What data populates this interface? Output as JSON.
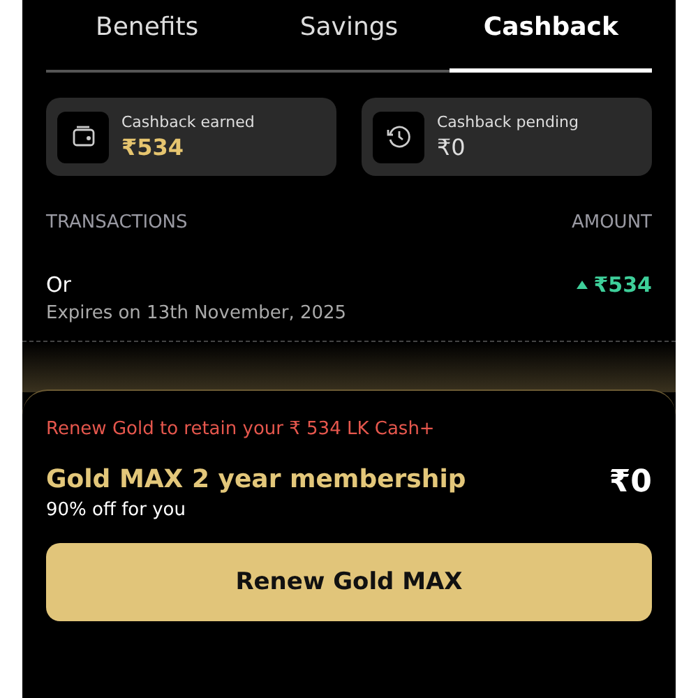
{
  "tabs": [
    {
      "label": "Benefits",
      "selected": false
    },
    {
      "label": "Savings",
      "selected": false
    },
    {
      "label": "Cashback",
      "selected": true
    }
  ],
  "summary_cards": [
    {
      "kind": "wallet",
      "label": "Cashback earned",
      "value": "₹534",
      "highlight": true
    },
    {
      "kind": "history",
      "label": "Cashback pending",
      "value": "₹0",
      "highlight": false
    }
  ],
  "transactions": {
    "heading": "TRANSACTIONS",
    "amount_heading": "AMOUNT",
    "rows": [
      {
        "title": "Or",
        "expiry": "Expires on 13th November, 2025",
        "amount": "₹534",
        "kind": "credit"
      }
    ]
  },
  "renew_sheet": {
    "warning": "Renew Gold to retain your ₹ 534 LK Cash+",
    "plan": "Gold MAX 2 year membership",
    "offer": "90% off for you",
    "price": "₹0",
    "button": "Renew Gold MAX"
  }
}
